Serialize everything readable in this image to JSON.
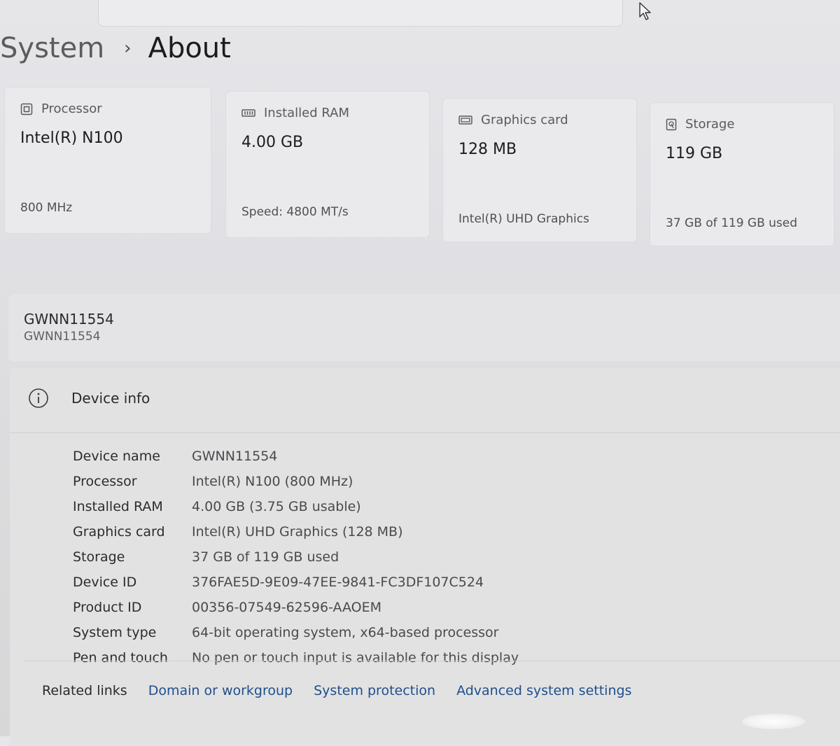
{
  "breadcrumb": {
    "parent": "System",
    "separator": "›",
    "current": "About"
  },
  "spec_cards": [
    {
      "icon": "processor-icon",
      "title": "Processor",
      "value": "Intel(R) N100",
      "detail": "800 MHz"
    },
    {
      "icon": "ram-icon",
      "title": "Installed RAM",
      "value": "4.00 GB",
      "detail": "Speed: 4800 MT/s"
    },
    {
      "icon": "graphics-card-icon",
      "title": "Graphics card",
      "value": "128 MB",
      "detail": "Intel(R) UHD Graphics"
    },
    {
      "icon": "storage-icon",
      "title": "Storage",
      "value": "119 GB",
      "detail": "37 GB of 119 GB used"
    }
  ],
  "device": {
    "name": "GWNN11554",
    "subtitle": "GWNN11554"
  },
  "device_info": {
    "title": "Device info",
    "icon": "info-icon",
    "rows": [
      {
        "label": "Device name",
        "value": "GWNN11554"
      },
      {
        "label": "Processor",
        "value": "Intel(R) N100 (800 MHz)"
      },
      {
        "label": "Installed RAM",
        "value": "4.00 GB (3.75 GB usable)"
      },
      {
        "label": "Graphics card",
        "value": "Intel(R) UHD Graphics (128 MB)"
      },
      {
        "label": "Storage",
        "value": "37 GB of 119 GB used"
      },
      {
        "label": "Device ID",
        "value": "376FAE5D-9E09-47EE-9841-FC3DF107C524"
      },
      {
        "label": "Product ID",
        "value": "00356-07549-62596-AAOEM"
      },
      {
        "label": "System type",
        "value": "64-bit operating system, x64-based processor"
      },
      {
        "label": "Pen and touch",
        "value": "No pen or touch input is available for this display"
      }
    ]
  },
  "related_links": {
    "label": "Related links",
    "links": [
      "Domain or workgroup",
      "System protection",
      "Advanced system settings"
    ]
  },
  "colors": {
    "background": "#e1e1e5",
    "card": "#eaeaec",
    "link": "#1f4f8c"
  }
}
